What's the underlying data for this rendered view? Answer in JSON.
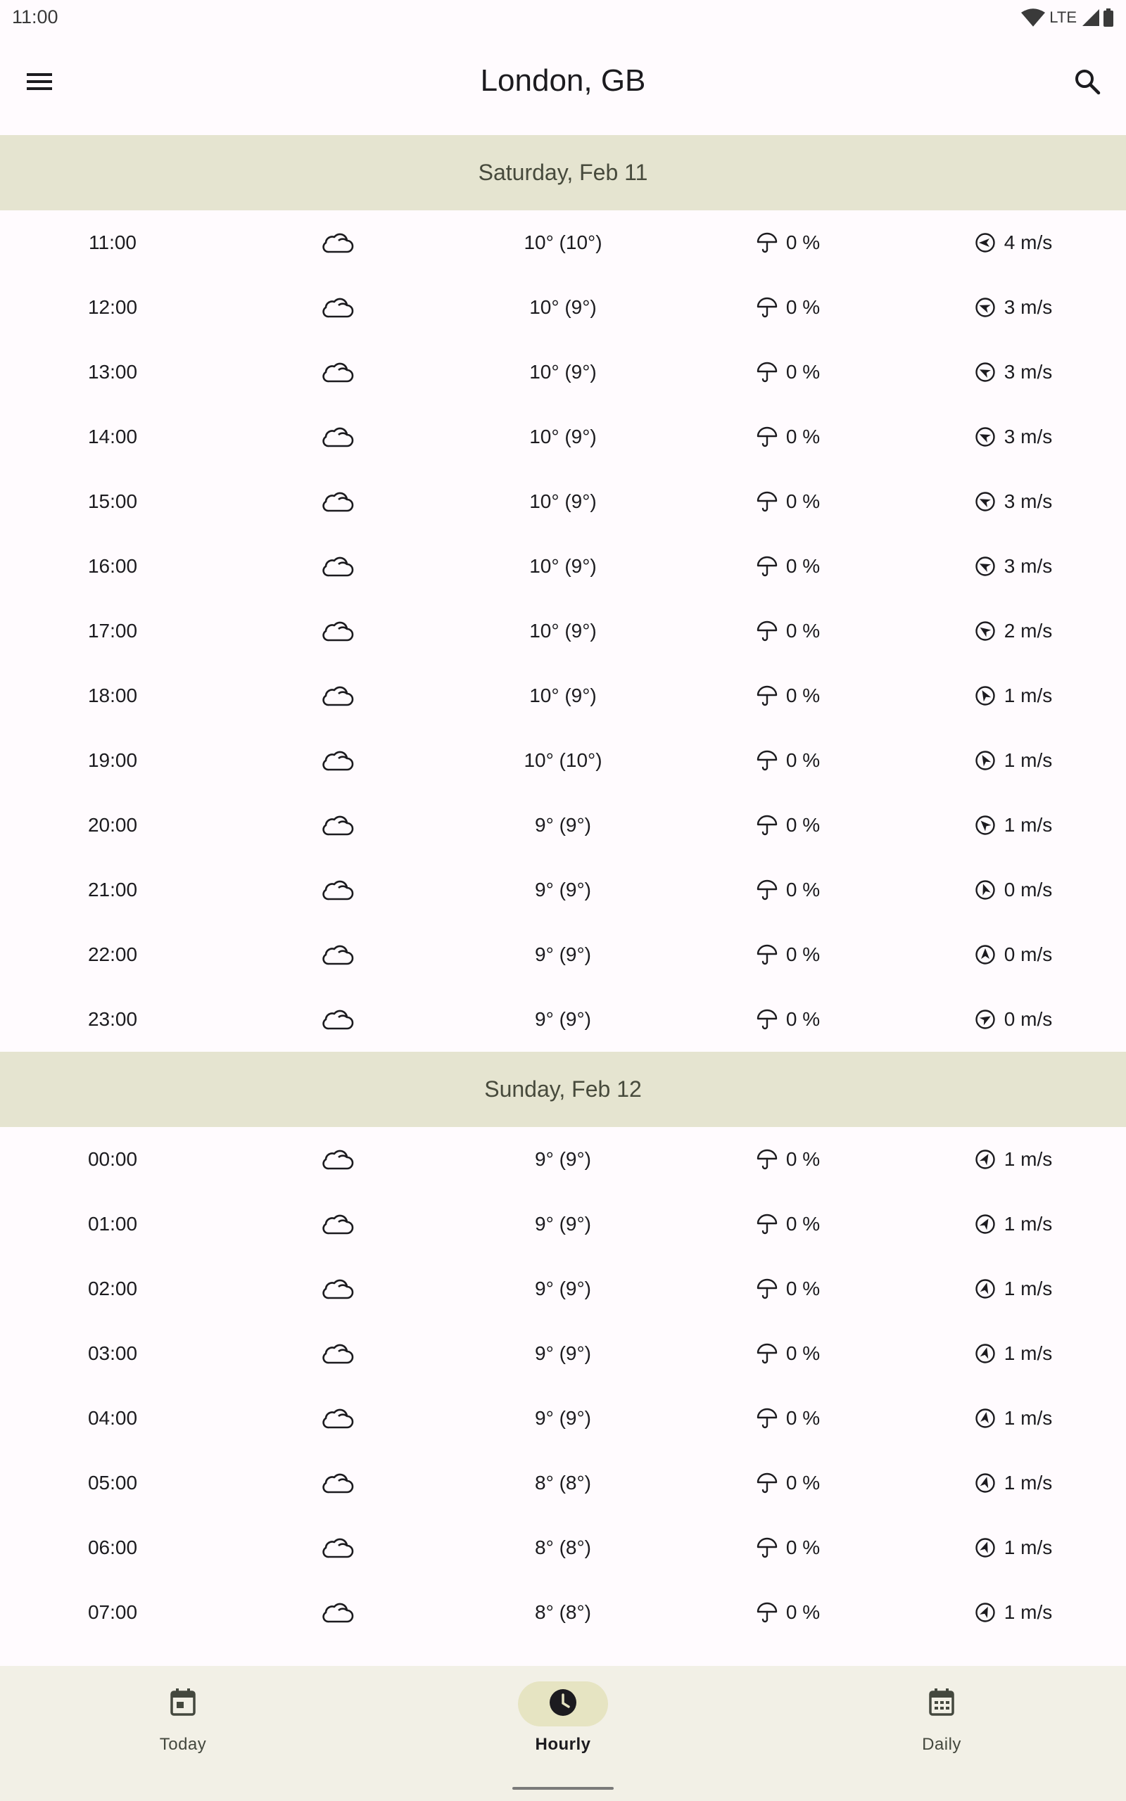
{
  "status_bar": {
    "time": "11:00",
    "network": "LTE"
  },
  "app_bar": {
    "title": "London, GB",
    "menu_icon": "menu-icon",
    "search_icon": "search-icon"
  },
  "days": [
    {
      "label": "Saturday, Feb 11",
      "hours": [
        {
          "time": "11:00",
          "temp": "10° (10°)",
          "precip": "0 %",
          "wind": "4 m/s",
          "wind_deg": 270
        },
        {
          "time": "12:00",
          "temp": "10° (9°)",
          "precip": "0 %",
          "wind": "3 m/s",
          "wind_deg": 290
        },
        {
          "time": "13:00",
          "temp": "10° (9°)",
          "precip": "0 %",
          "wind": "3 m/s",
          "wind_deg": 295
        },
        {
          "time": "14:00",
          "temp": "10° (9°)",
          "precip": "0 %",
          "wind": "3 m/s",
          "wind_deg": 295
        },
        {
          "time": "15:00",
          "temp": "10° (9°)",
          "precip": "0 %",
          "wind": "3 m/s",
          "wind_deg": 295
        },
        {
          "time": "16:00",
          "temp": "10° (9°)",
          "precip": "0 %",
          "wind": "3 m/s",
          "wind_deg": 295
        },
        {
          "time": "17:00",
          "temp": "10° (9°)",
          "precip": "0 %",
          "wind": "2 m/s",
          "wind_deg": 305
        },
        {
          "time": "18:00",
          "temp": "10° (9°)",
          "precip": "0 %",
          "wind": "1 m/s",
          "wind_deg": 330
        },
        {
          "time": "19:00",
          "temp": "10° (10°)",
          "precip": "0 %",
          "wind": "1 m/s",
          "wind_deg": 330
        },
        {
          "time": "20:00",
          "temp": "9° (9°)",
          "precip": "0 %",
          "wind": "1 m/s",
          "wind_deg": 315
        },
        {
          "time": "21:00",
          "temp": "9° (9°)",
          "precip": "0 %",
          "wind": "0 m/s",
          "wind_deg": 340
        },
        {
          "time": "22:00",
          "temp": "9° (9°)",
          "precip": "0 %",
          "wind": "0 m/s",
          "wind_deg": 0
        },
        {
          "time": "23:00",
          "temp": "9° (9°)",
          "precip": "0 %",
          "wind": "0 m/s",
          "wind_deg": 60
        }
      ]
    },
    {
      "label": "Sunday, Feb 12",
      "hours": [
        {
          "time": "00:00",
          "temp": "9° (9°)",
          "precip": "0 %",
          "wind": "1 m/s",
          "wind_deg": 30
        },
        {
          "time": "01:00",
          "temp": "9° (9°)",
          "precip": "0 %",
          "wind": "1 m/s",
          "wind_deg": 30
        },
        {
          "time": "02:00",
          "temp": "9° (9°)",
          "precip": "0 %",
          "wind": "1 m/s",
          "wind_deg": 15
        },
        {
          "time": "03:00",
          "temp": "9° (9°)",
          "precip": "0 %",
          "wind": "1 m/s",
          "wind_deg": 15
        },
        {
          "time": "04:00",
          "temp": "9° (9°)",
          "precip": "0 %",
          "wind": "1 m/s",
          "wind_deg": 10
        },
        {
          "time": "05:00",
          "temp": "8° (8°)",
          "precip": "0 %",
          "wind": "1 m/s",
          "wind_deg": 15
        },
        {
          "time": "06:00",
          "temp": "8° (8°)",
          "precip": "0 %",
          "wind": "1 m/s",
          "wind_deg": 20
        },
        {
          "time": "07:00",
          "temp": "8° (8°)",
          "precip": "0 %",
          "wind": "1 m/s",
          "wind_deg": 25
        }
      ]
    }
  ],
  "icons": {
    "condition": "cloud-icon",
    "precip": "umbrella-icon",
    "wind": "wind-direction-icon"
  },
  "bottom_nav": {
    "items": [
      {
        "label": "Today",
        "icon": "calendar-today-icon",
        "active": false
      },
      {
        "label": "Hourly",
        "icon": "clock-icon",
        "active": true
      },
      {
        "label": "Daily",
        "icon": "calendar-month-icon",
        "active": false
      }
    ]
  },
  "colors": {
    "day_header_bg": "#e5e4d0",
    "nav_bg": "#f2f0e6",
    "nav_active_pill": "#e6e4c2"
  }
}
